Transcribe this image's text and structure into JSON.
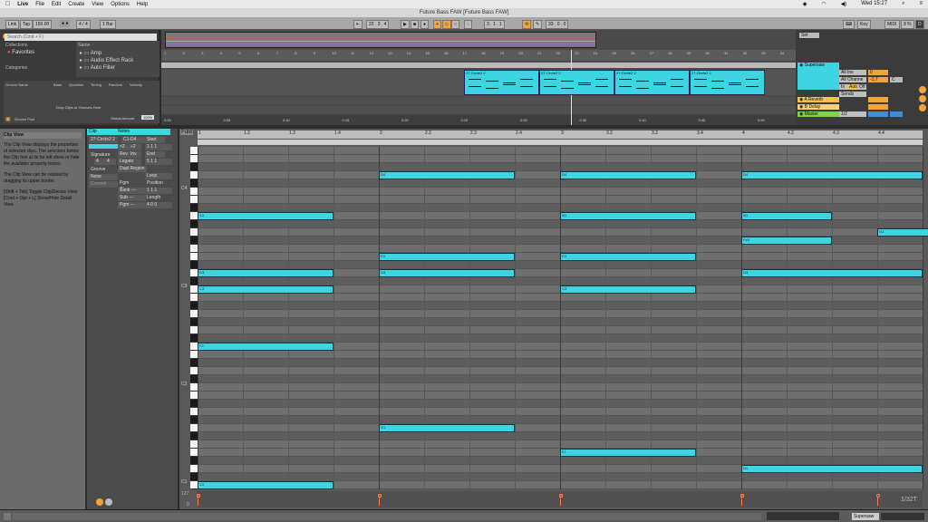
{
  "menubar": {
    "app": "Live",
    "items": [
      "File",
      "Edit",
      "Create",
      "View",
      "Options",
      "Help"
    ],
    "clock": "Wed 15:27"
  },
  "window_title": "Future Bass FAW  [Future Bass FAW]",
  "transport": {
    "link": "Link",
    "tap": "Tap",
    "tempo": "150.00",
    "signature": "4 / 4",
    "quantize": "1 Bar",
    "position": "22 .  3 .  4",
    "loop_start": "3 .  1 .  1",
    "loop_length": "33 .  0 .  0",
    "key_label": "Key",
    "midi_label": "MIDI",
    "cpu": "9 %",
    "d_label": "D"
  },
  "browser": {
    "search_placeholder": "Search (Cmd + F)",
    "collections_label": "Collections",
    "favorites": "Favorites",
    "categories_label": "Categories",
    "name_header": "Name",
    "items": [
      "Amp",
      "Audio Effect Rack",
      "Auto Filter"
    ]
  },
  "groove_pool": {
    "headers": [
      "Groove Name",
      "Base",
      "Quantize",
      "Timing",
      "Random",
      "Velocity"
    ],
    "empty_text": "Drop Clips or Grooves Here",
    "global_amount_label": "Global Amount",
    "global_amount": "100%",
    "title": "Groove Pool"
  },
  "arrangement": {
    "ruler": [
      "1",
      "2",
      "3",
      "4",
      "5",
      "6",
      "7",
      "8",
      "9",
      "10",
      "11",
      "12",
      "13",
      "14",
      "15",
      "16",
      "17",
      "18",
      "19",
      "20",
      "21",
      "22",
      "23",
      "24",
      "25",
      "26",
      "27",
      "28",
      "29",
      "30",
      "31",
      "32",
      "33",
      "34"
    ],
    "time_ruler": [
      "0:00",
      "0:05",
      "0:10",
      "0:15",
      "0:20",
      "0:25",
      "0:30",
      "0:35",
      "0:40",
      "0:45",
      "0:50"
    ],
    "clip_names": [
      "27-Circle2 2",
      "27-Circle2 2",
      "27-Circle2 2",
      "27-Circle2 2"
    ]
  },
  "mixer": {
    "set_label": "Set",
    "tracks": [
      {
        "name": "Supersaw",
        "color": "#3fd4e2"
      },
      {
        "name": "A Reverb",
        "color": "#f2c44a"
      },
      {
        "name": "B Delay",
        "color": "#f2d27a"
      },
      {
        "name": "Master",
        "color": "#7fd24a"
      }
    ],
    "routing": [
      "All Ins",
      "All Channe",
      "In",
      "Auto",
      "Off",
      "Sends"
    ],
    "values": [
      "-1.7",
      "0",
      "C",
      "1/2"
    ]
  },
  "clip_view": {
    "title": "Clip View",
    "text1": "The Clip View displays the properties of selected clips. The selectors below the Clip box at its far left show or hide the available property boxes.",
    "text2": "The Clip View can be resized by dragging its upper border.",
    "text3": "[Shift + Tab] Toggle Clip/Device View\n[Cmd + Opt + L] Show/Hide Detail View"
  },
  "clip_box": {
    "clip_label": "Clip",
    "clip_name": "27-Circle2 2",
    "signature_label": "Signature",
    "sig_num": "4",
    "sig_den": "4",
    "groove_label": "Groove",
    "groove_value": "None",
    "commit": "Commit",
    "notes_label": "Notes",
    "range": "C1-D4",
    "start_label": "Start",
    "set_label": "Set",
    "end_label": "End",
    "legato": "Legato",
    "dupl": "Dupl.Region",
    "loop": "Loop",
    "pgm_change": "Pgm Change",
    "position_label": "Position",
    "length_label": "Length",
    "bank": "Bank ---",
    "sub": "Sub ---",
    "pgm": "Pgm ---",
    "start_val": "1  1  1",
    "end_val": "5  1  1",
    "pos_val": "1  1  1",
    "len_val": "4  0  0",
    "x2": "×2",
    "half": "÷2",
    "rev": "Rev",
    "inv": "Inv"
  },
  "piano_roll": {
    "fold": "Fold",
    "ruler": [
      "1",
      "1.2",
      "1.3",
      "1.4",
      "2",
      "2.2",
      "2.3",
      "2.4",
      "3",
      "3.2",
      "3.3",
      "3.4",
      "4",
      "4.2",
      "4.3",
      "4.4"
    ],
    "octave_labels": [
      "C4",
      "C3",
      "C2",
      "C1"
    ],
    "grid": "1/32T",
    "velocity_label": "127",
    "velocity_zero": "0",
    "notes": [
      {
        "pitch": "D4",
        "bar": 2,
        "beats": 3
      },
      {
        "pitch": "D4",
        "bar": 3,
        "beats": 3
      },
      {
        "pitch": "D4",
        "bar": 4,
        "beats": 4
      },
      {
        "pitch": "A3",
        "bar": 1,
        "beats": 3
      },
      {
        "pitch": "A3",
        "bar": 3,
        "beats": 3
      },
      {
        "pitch": "A3",
        "bar": 4,
        "beats": 2
      },
      {
        "pitch": "G3",
        "bar": 4.4,
        "beats": 2
      },
      {
        "pitch": "E3",
        "bar": 2,
        "beats": 3
      },
      {
        "pitch": "E3",
        "bar": 3,
        "beats": 3
      },
      {
        "pitch": "F#3",
        "bar": 4,
        "beats": 2
      },
      {
        "pitch": "C3",
        "bar": 1,
        "beats": 3
      },
      {
        "pitch": "C3",
        "bar": 3,
        "beats": 3
      },
      {
        "pitch": "D3",
        "bar": 1,
        "beats": 3
      },
      {
        "pitch": "D3",
        "bar": 2,
        "beats": 3
      },
      {
        "pitch": "D3",
        "bar": 4,
        "beats": 4
      },
      {
        "pitch": "F2",
        "bar": 1,
        "beats": 3
      },
      {
        "pitch": "G1",
        "bar": 2,
        "beats": 3
      },
      {
        "pitch": "E1",
        "bar": 3,
        "beats": 3
      },
      {
        "pitch": "D1",
        "bar": 4,
        "beats": 4
      },
      {
        "pitch": "C1",
        "bar": 1,
        "beats": 3
      }
    ]
  },
  "status": {
    "track": "Supersaw"
  }
}
